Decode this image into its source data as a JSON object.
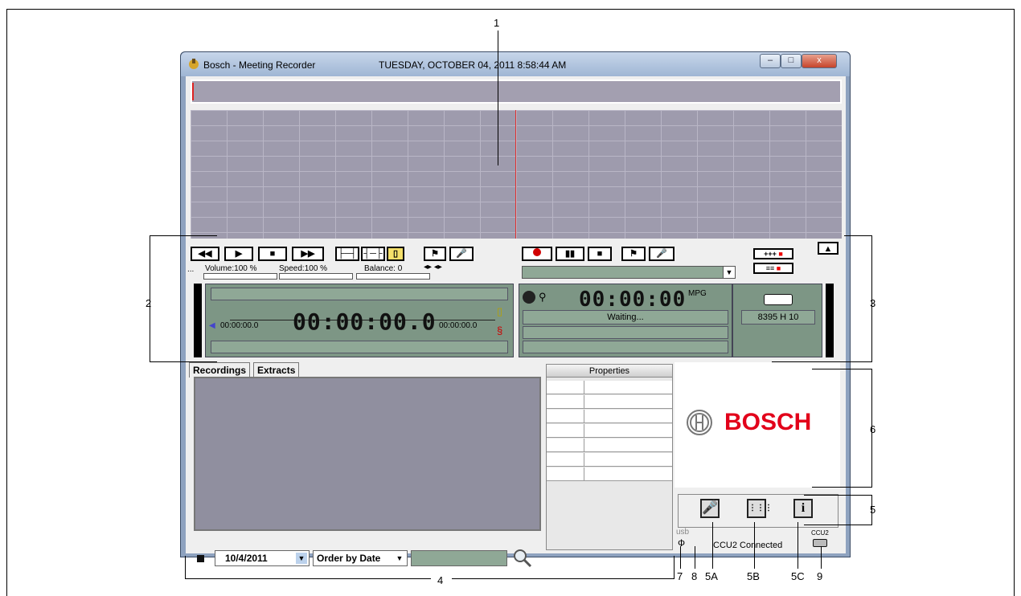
{
  "window": {
    "title": "Bosch - Meeting Recorder",
    "datetime": "TUESDAY, OCTOBER 04, 2011 8:58:44 AM",
    "minimize": "–",
    "maximize": "□",
    "close": "x"
  },
  "playback": {
    "rewind": "◀◀",
    "play": "▶",
    "stop": "■",
    "fast_forward": "▶▶",
    "volume_label": "Volume:100 %",
    "speed_label": "Speed:100 %",
    "balance_label": "Balance: 0",
    "dots": "...",
    "time": "00:00:00.0",
    "start_time": "00:00:00.0",
    "end_time": "00:00:00.0"
  },
  "recording": {
    "time": "00:00:00",
    "format": "MPG",
    "status": "Waiting...",
    "device_id": "8395 H 10"
  },
  "tabs": [
    {
      "label": "Recordings",
      "active": true
    },
    {
      "label": "Extracts",
      "active": false
    }
  ],
  "filter": {
    "date": "10/4/2011",
    "order": "Order by Date",
    "search_value": ""
  },
  "properties": {
    "header": "Properties"
  },
  "logo": {
    "text": "BOSCH",
    "color": "#e2001a"
  },
  "status": {
    "usb_label": "usb",
    "connection": "CCU2 Connected",
    "ccu_label": "CCU2"
  },
  "callouts": {
    "c1": "1",
    "c2": "2",
    "c3": "3",
    "c4": "4",
    "c5": "5",
    "c6": "6",
    "c7": "7",
    "c8": "8",
    "c5a": "5A",
    "c5b": "5B",
    "c5c": "5C",
    "c9": "9"
  }
}
